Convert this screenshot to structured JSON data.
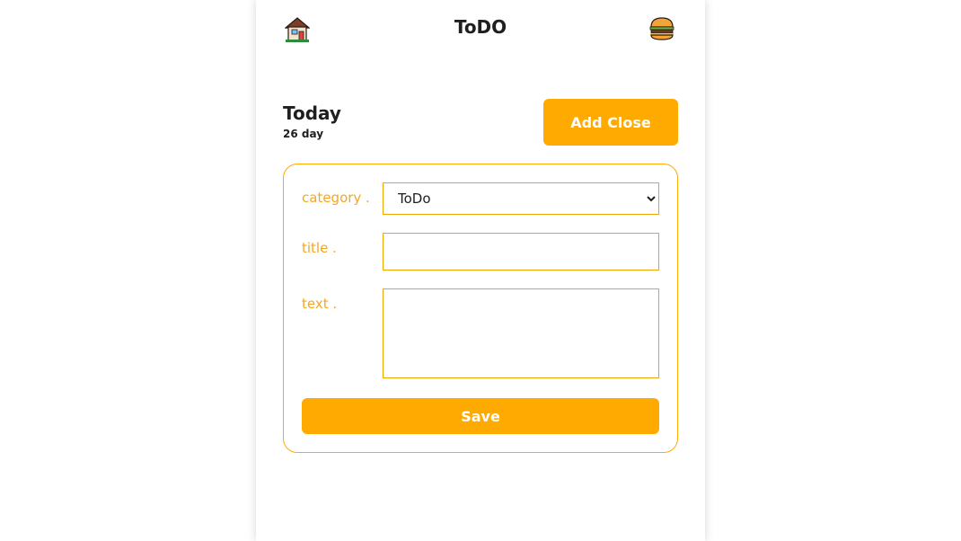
{
  "header": {
    "title": "ToDO",
    "left_icon": "house-icon",
    "right_icon": "hamburger-menu-icon"
  },
  "day": {
    "title": "Today",
    "subtitle": "26 day"
  },
  "add_close_label": "Add Close",
  "form": {
    "category_label": "category .",
    "category_options": [
      "ToDo"
    ],
    "category_value": "ToDo",
    "title_label": "title .",
    "title_value": "",
    "text_label": "text .",
    "text_value": "",
    "save_label": "Save"
  },
  "colors": {
    "accent": "#ffaa00",
    "label": "#f5a623",
    "text": "#1f1f1f"
  }
}
